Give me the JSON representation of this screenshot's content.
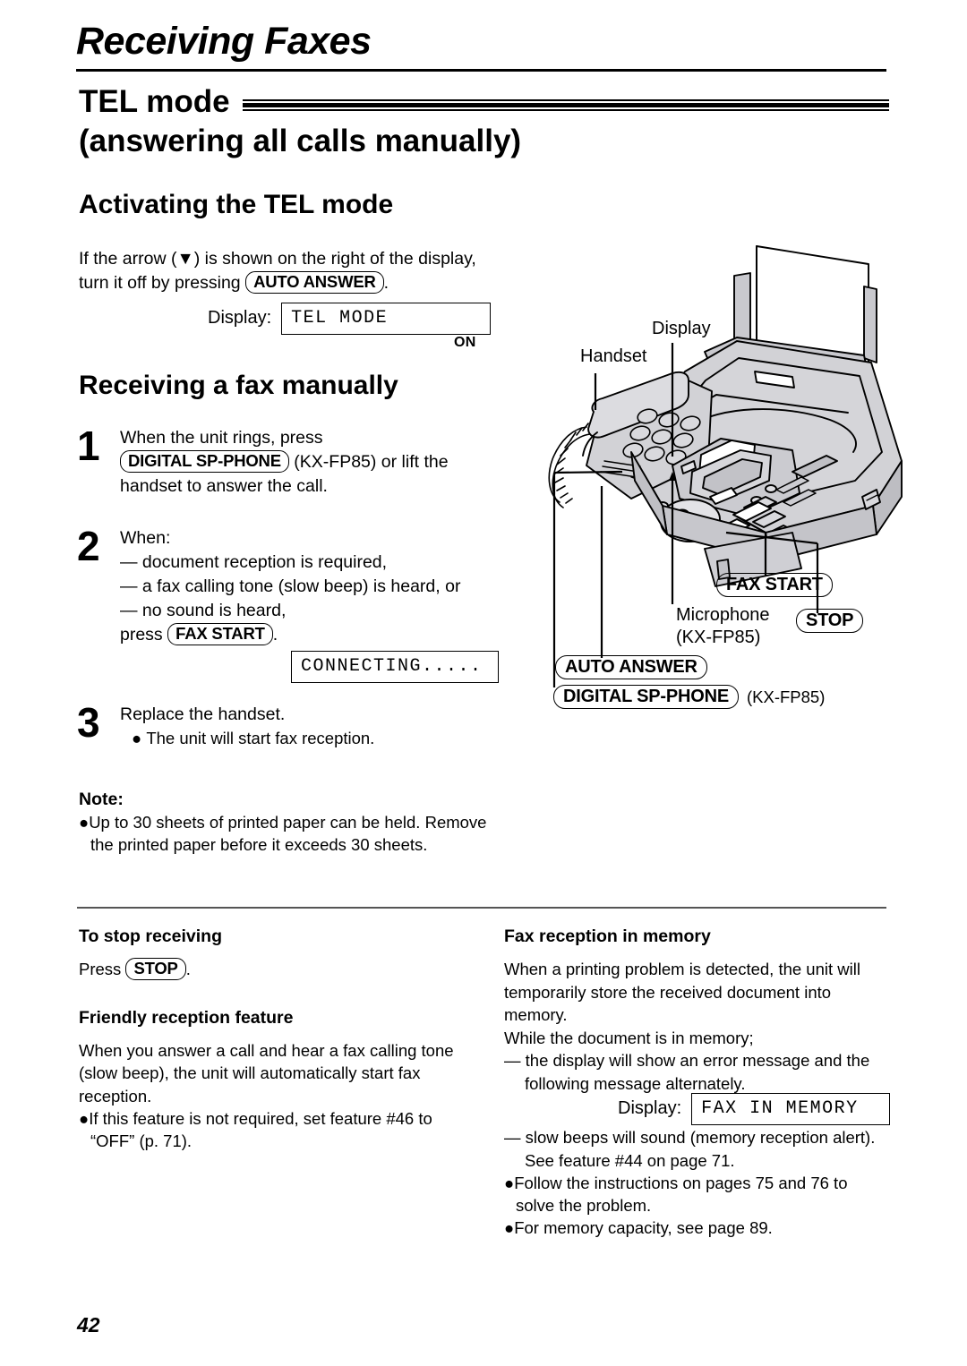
{
  "chapter": {
    "title": "Receiving Faxes"
  },
  "section": {
    "title_line1": "TEL mode",
    "title_line2": "(answering all calls manually)"
  },
  "activating": {
    "heading": "Activating the TEL mode",
    "intro_part1": "If the arrow (",
    "arrow_glyph": "▼",
    "intro_part2": ") is shown on the right of the display, turn it off by pressing ",
    "key_auto_answer": "AUTO ANSWER",
    "intro_part3": ".",
    "display_label": "Display:",
    "lcd_text": "TEL MODE",
    "on_label": "ON"
  },
  "receiving": {
    "heading": "Receiving a fax manually",
    "steps": [
      {
        "number": "1",
        "text_a": "When the unit rings, press",
        "key": "DIGITAL SP-PHONE",
        "text_b": " (KX-FP85) or lift the handset to answer the call."
      },
      {
        "number": "2",
        "text_a": "When:",
        "bullet1": "— document reception is required,",
        "bullet2": "— a fax calling tone (slow beep) is heard, or",
        "bullet3": "— no sound is heard,",
        "press_label": "press ",
        "key": "FAX START",
        "period": "."
      },
      {
        "number": "3",
        "text_a": "Replace the handset.",
        "bullet1": "The unit will start fax reception."
      }
    ],
    "display_label": "Display:",
    "lcd_connecting": "CONNECTING....."
  },
  "note": {
    "title": "Note:",
    "bullets": [
      "Up to 30 sheets of printed paper can be held. Remove the printed paper before it exceeds 30 sheets."
    ]
  },
  "illustration": {
    "labels": {
      "display": "Display",
      "handset": "Handset",
      "microphone_line1": "Microphone",
      "microphone_line2": "(KX-FP85)"
    },
    "keys": {
      "fax_start": "FAX START",
      "stop": "STOP",
      "auto_answer": "AUTO ANSWER",
      "digital_sp_phone": "DIGITAL SP-PHONE",
      "digital_sp_phone_model": "(KX-FP85)"
    },
    "colors": {
      "body_fill": "#d2d2d6",
      "body_shade": "#bdbdc2",
      "outline": "#000000",
      "paper_fill": "#ffffff"
    }
  },
  "bottom_left": {
    "heading1": "To stop receiving",
    "press_label": "Press ",
    "key_stop": "STOP",
    "press_period": ".",
    "heading2": "Friendly reception feature",
    "para1": "When you answer a call and hear a fax calling tone (slow beep), the unit will automatically start fax reception.",
    "bullet1": "If this feature is not required, set feature #46 to “OFF” (p. 71)."
  },
  "bottom_right": {
    "heading": "Fax reception in memory",
    "para1": "When a printing problem is detected, the unit will temporarily store the received document into memory.",
    "para2": "While the document is in memory;",
    "dash1": "— the display will show an error message and the following message alternately.",
    "display_label": "Display:",
    "lcd_text": "FAX IN MEMORY",
    "dash2": "— slow beeps will sound (memory reception alert). See feature #44 on page 71.",
    "bullet1": "Follow the instructions on pages 75 and 76 to solve the problem.",
    "bullet2": "For memory capacity, see page 89."
  },
  "footer": {
    "page_number": "42"
  }
}
